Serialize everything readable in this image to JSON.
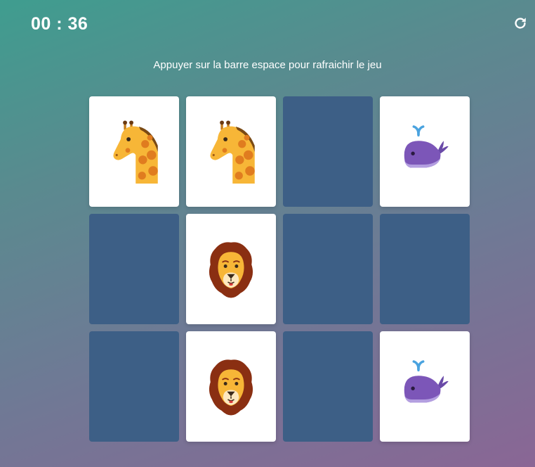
{
  "timer": "00 : 36",
  "hint": "Appuyer sur la barre espace pour rafraichir le jeu",
  "refresh_icon": "refresh-icon",
  "colors": {
    "card_back": "#3d5f86",
    "card_face": "#ffffff",
    "text": "#ffffff"
  },
  "cards": [
    {
      "state": "up",
      "animal": "giraffe"
    },
    {
      "state": "up",
      "animal": "giraffe"
    },
    {
      "state": "down",
      "animal": ""
    },
    {
      "state": "up",
      "animal": "whale"
    },
    {
      "state": "down",
      "animal": ""
    },
    {
      "state": "up",
      "animal": "lion"
    },
    {
      "state": "down",
      "animal": ""
    },
    {
      "state": "down",
      "animal": ""
    },
    {
      "state": "down",
      "animal": ""
    },
    {
      "state": "up",
      "animal": "lion"
    },
    {
      "state": "down",
      "animal": ""
    },
    {
      "state": "up",
      "animal": "whale"
    }
  ]
}
